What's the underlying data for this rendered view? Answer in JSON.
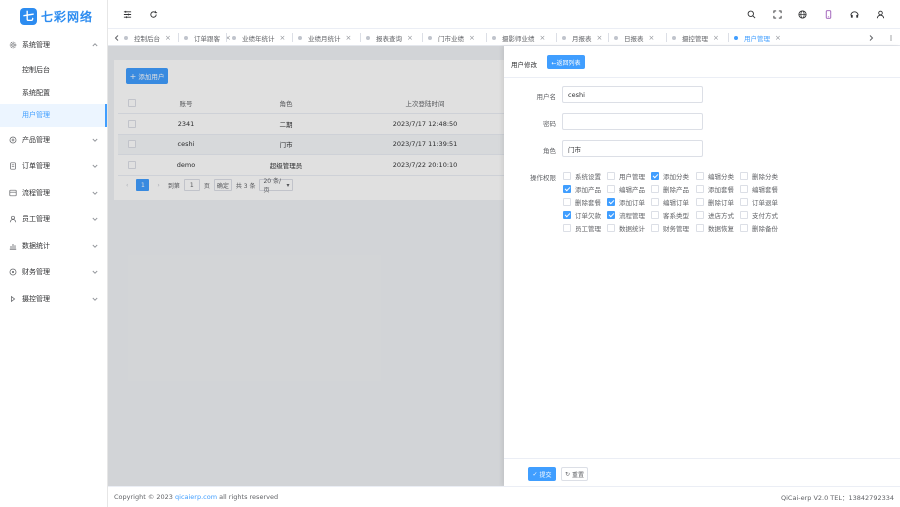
{
  "app": {
    "logo_mark": "七",
    "logo_text": "七彩网络",
    "brand_color": "#409eff"
  },
  "sidebar": {
    "groups": [
      {
        "label": "系统管理",
        "icon": "gear-icon",
        "expanded": true,
        "items": [
          {
            "label": "控制后台",
            "active": false
          },
          {
            "label": "系统配置",
            "active": false
          },
          {
            "label": "用户管理",
            "active": true
          }
        ]
      },
      {
        "label": "产品管理",
        "icon": "box-icon",
        "expanded": false
      },
      {
        "label": "订单管理",
        "icon": "document-icon",
        "expanded": false
      },
      {
        "label": "流程管理",
        "icon": "workflow-icon",
        "expanded": false
      },
      {
        "label": "员工管理",
        "icon": "user-icon",
        "expanded": false
      },
      {
        "label": "数据统计",
        "icon": "chart-icon",
        "expanded": false
      },
      {
        "label": "财务管理",
        "icon": "wallet-icon",
        "expanded": false
      },
      {
        "label": "摄控管理",
        "icon": "camera-icon",
        "expanded": false
      }
    ]
  },
  "topbar": {
    "icons": [
      "menu-toggle-icon",
      "refresh-icon",
      "search-icon",
      "fullscreen-icon",
      "language-icon",
      "mobile-icon",
      "theme-icon",
      "user-icon"
    ]
  },
  "tabs": [
    {
      "label": "控制后台",
      "active": false
    },
    {
      "label": "订单跟客",
      "active": false
    },
    {
      "label": "业绩年统计",
      "active": false
    },
    {
      "label": "业绩月统计",
      "active": false
    },
    {
      "label": "报表查询",
      "active": false
    },
    {
      "label": "门市业绩",
      "active": false
    },
    {
      "label": "摄影师业绩",
      "active": false
    },
    {
      "label": "月报表",
      "active": false
    },
    {
      "label": "日报表",
      "active": false
    },
    {
      "label": "摄控管理",
      "active": false
    },
    {
      "label": "用户管理",
      "active": true
    }
  ],
  "user_list": {
    "add_button": "添加用户",
    "columns": [
      "账号",
      "角色",
      "上次登陆时间"
    ],
    "rows": [
      {
        "account": "2341",
        "role": "二期",
        "last_login": "2023/7/17 12:48:50"
      },
      {
        "account": "ceshi",
        "role": "门市",
        "last_login": "2023/7/17 11:39:51"
      },
      {
        "account": "demo",
        "role": "超级管理员",
        "last_login": "2023/7/22 20:10:10"
      }
    ],
    "pagination": {
      "current_page": "1",
      "goto_label": "到第",
      "goto_value": "1",
      "page_suffix": "页",
      "confirm": "确定",
      "total": "共 3 条",
      "page_size": "20 条/页"
    }
  },
  "drawer": {
    "title": "用户修改",
    "back_button": "←返回列表",
    "fields": [
      {
        "label": "用户名",
        "value": "ceshi"
      },
      {
        "label": "密码",
        "value": ""
      },
      {
        "label": "角色",
        "value": "门市"
      }
    ],
    "permissions_label": "操作权限",
    "permissions": [
      [
        {
          "label": "系统设置",
          "checked": false
        },
        {
          "label": "用户管理",
          "checked": false
        },
        {
          "label": "添加分类",
          "checked": true
        },
        {
          "label": "编辑分类",
          "checked": false
        },
        {
          "label": "删除分类",
          "checked": false
        }
      ],
      [
        {
          "label": "添加产品",
          "checked": true
        },
        {
          "label": "编辑产品",
          "checked": false
        },
        {
          "label": "删除产品",
          "checked": false
        },
        {
          "label": "添加套餐",
          "checked": false
        },
        {
          "label": "编辑套餐",
          "checked": false
        }
      ],
      [
        {
          "label": "删除套餐",
          "checked": false
        },
        {
          "label": "添加订单",
          "checked": true
        },
        {
          "label": "编辑订单",
          "checked": false
        },
        {
          "label": "删除订单",
          "checked": false
        },
        {
          "label": "订单退单",
          "checked": false
        }
      ],
      [
        {
          "label": "订单欠款",
          "checked": true
        },
        {
          "label": "流程管理",
          "checked": true
        },
        {
          "label": "客系类型",
          "checked": false
        },
        {
          "label": "进店方式",
          "checked": false
        },
        {
          "label": "支付方式",
          "checked": false
        }
      ],
      [
        {
          "label": "员工管理",
          "checked": false
        },
        {
          "label": "数据统计",
          "checked": false
        },
        {
          "label": "财务管理",
          "checked": false
        },
        {
          "label": "数据恢复",
          "checked": false
        },
        {
          "label": "删除备份",
          "checked": false
        }
      ]
    ],
    "submit_button": "提交",
    "reset_button": "重置"
  },
  "footer": {
    "copyright_prefix": "Copyright © 2023",
    "link": "qicaierp.com",
    "copyright_suffix": "all rights reserved",
    "version": "QiCai-erp V2.0 TEL：13842792334"
  }
}
